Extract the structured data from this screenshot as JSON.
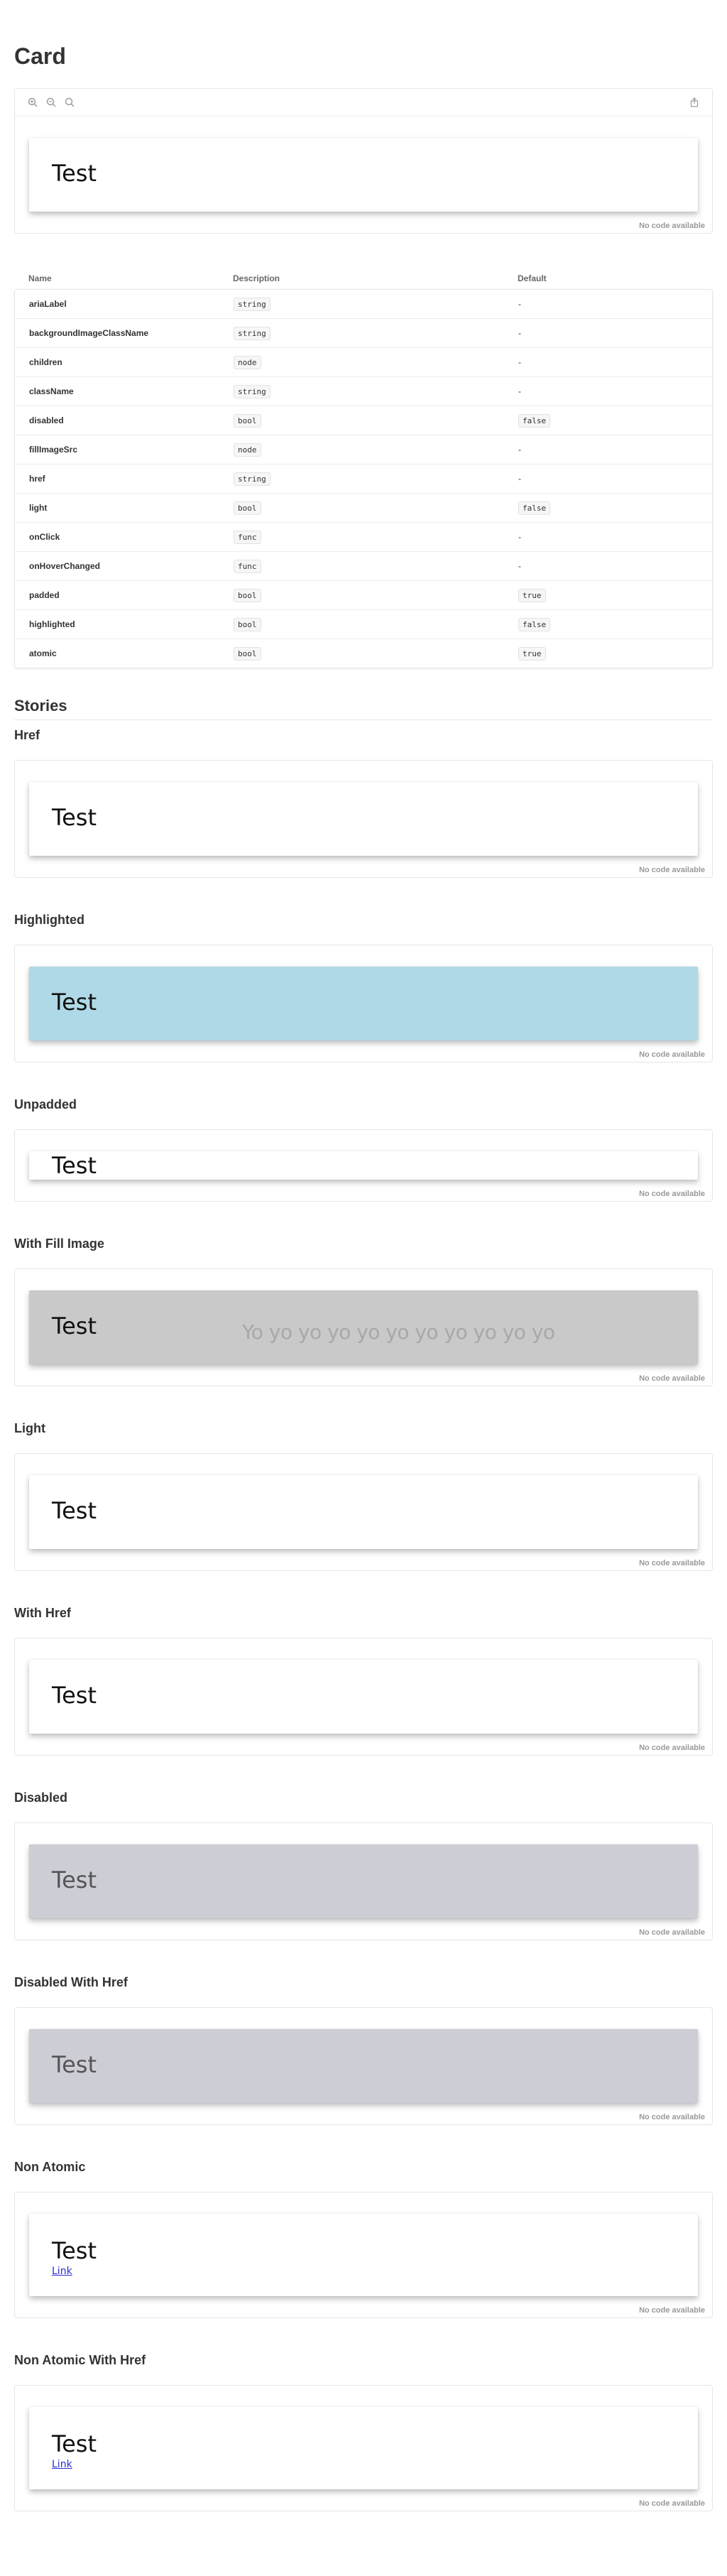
{
  "page": {
    "title": "Card"
  },
  "toolbar": {
    "zoom_in_icon": "zoom-in-icon",
    "zoom_out_icon": "zoom-out-icon",
    "zoom_reset_icon": "zoom-reset-icon",
    "share_icon": "share-icon"
  },
  "preview": {
    "card_text": "Test",
    "code_note": "No code available"
  },
  "props": {
    "headers": {
      "name": "Name",
      "description": "Description",
      "default": "Default"
    },
    "rows": [
      {
        "name": "ariaLabel",
        "type": "string",
        "default": "-"
      },
      {
        "name": "backgroundImageClassName",
        "type": "string",
        "default": "-"
      },
      {
        "name": "children",
        "type": "node",
        "default": "-"
      },
      {
        "name": "className",
        "type": "string",
        "default": "-"
      },
      {
        "name": "disabled",
        "type": "bool",
        "default": "false"
      },
      {
        "name": "fillImageSrc",
        "type": "node",
        "default": "-"
      },
      {
        "name": "href",
        "type": "string",
        "default": "-"
      },
      {
        "name": "light",
        "type": "bool",
        "default": "false"
      },
      {
        "name": "onClick",
        "type": "func",
        "default": "-"
      },
      {
        "name": "onHoverChanged",
        "type": "func",
        "default": "-"
      },
      {
        "name": "padded",
        "type": "bool",
        "default": "true"
      },
      {
        "name": "highlighted",
        "type": "bool",
        "default": "false"
      },
      {
        "name": "atomic",
        "type": "bool",
        "default": "true"
      }
    ]
  },
  "stories": {
    "title": "Stories",
    "items": [
      {
        "title": "Href",
        "card_text": "Test",
        "code_note": "No code available"
      },
      {
        "title": "Highlighted",
        "card_text": "Test",
        "code_note": "No code available"
      },
      {
        "title": "Unpadded",
        "card_text": "Test",
        "code_note": "No code available"
      },
      {
        "title": "With Fill Image",
        "card_text": "Test",
        "fill_text": "Yo yo yo yo yo yo yo yo yo yo yo",
        "code_note": "No code available"
      },
      {
        "title": "Light",
        "card_text": "Test",
        "code_note": "No code available"
      },
      {
        "title": "With Href",
        "card_text": "Test",
        "code_note": "No code available"
      },
      {
        "title": "Disabled",
        "card_text": "Test",
        "code_note": "No code available"
      },
      {
        "title": "Disabled With Href",
        "card_text": "Test",
        "code_note": "No code available"
      },
      {
        "title": "Non Atomic",
        "card_text": "Test",
        "link_text": "Link",
        "code_note": "No code available"
      },
      {
        "title": "Non Atomic With Href",
        "card_text": "Test",
        "link_text": "Link",
        "code_note": "No code available"
      }
    ]
  },
  "colors": {
    "highlighted_bg": "#afd9e6",
    "fill_bg": "#c9c9c9",
    "disabled_bg": "#cdcdd6",
    "link": "#2b2bd6"
  }
}
